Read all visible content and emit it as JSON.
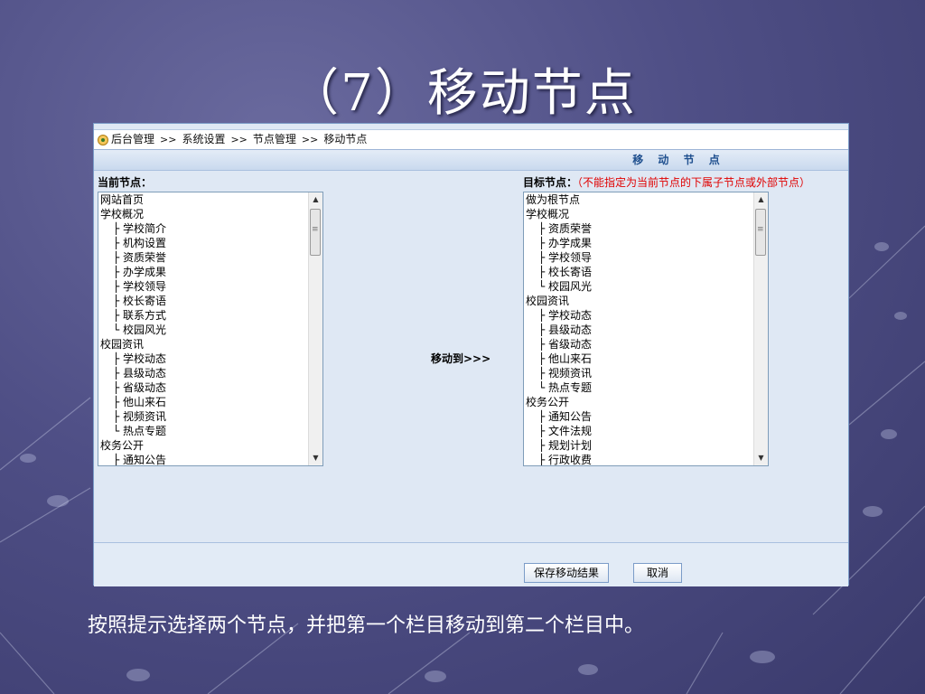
{
  "slide": {
    "title": "（7）移动节点",
    "caption": "按照提示选择两个节点，并把第一个栏目移动到第二个栏目中。"
  },
  "breadcrumb": [
    "后台管理",
    "系统设置",
    "节点管理",
    "移动节点"
  ],
  "breadcrumb_sep": ">>",
  "panel": {
    "title": "移 动 节 点",
    "current_label": "当前节点：",
    "target_label": "目标节点：",
    "target_hint": "（不能指定为当前节点的下属子节点或外部节点）",
    "move_to": "移动到>>>"
  },
  "current_nodes": [
    "网站首页",
    "学校概况",
    "├ 学校简介",
    "├ 机构设置",
    "├ 资质荣誉",
    "├ 办学成果",
    "├ 学校领导",
    "├ 校长寄语",
    "├ 联系方式",
    "└ 校园风光",
    "校园资讯",
    "├ 学校动态",
    "├ 县级动态",
    "├ 省级动态",
    "├ 他山来石",
    "├ 视频资讯",
    "└ 热点专题",
    "校务公开",
    "├ 通知公告"
  ],
  "target_nodes": [
    "做为根节点",
    "学校概况",
    "├ 资质荣誉",
    "├ 办学成果",
    "├ 学校领导",
    "├ 校长寄语",
    "└ 校园风光",
    "校园资讯",
    "├ 学校动态",
    "├ 县级动态",
    "├ 省级动态",
    "├ 他山来石",
    "├ 视频资讯",
    "└ 热点专题",
    "校务公开",
    "├ 通知公告",
    "├ 文件法规",
    "├ 规划计划",
    "├ 行政收费"
  ],
  "buttons": {
    "save": "保存移动结果",
    "cancel": "取消"
  },
  "icons": {
    "home": "home-icon",
    "scroll_up": "scroll-up-arrow-icon",
    "scroll_down": "scroll-down-arrow-icon"
  },
  "colors": {
    "hint": "#e00000",
    "panel_title": "#20508f"
  }
}
